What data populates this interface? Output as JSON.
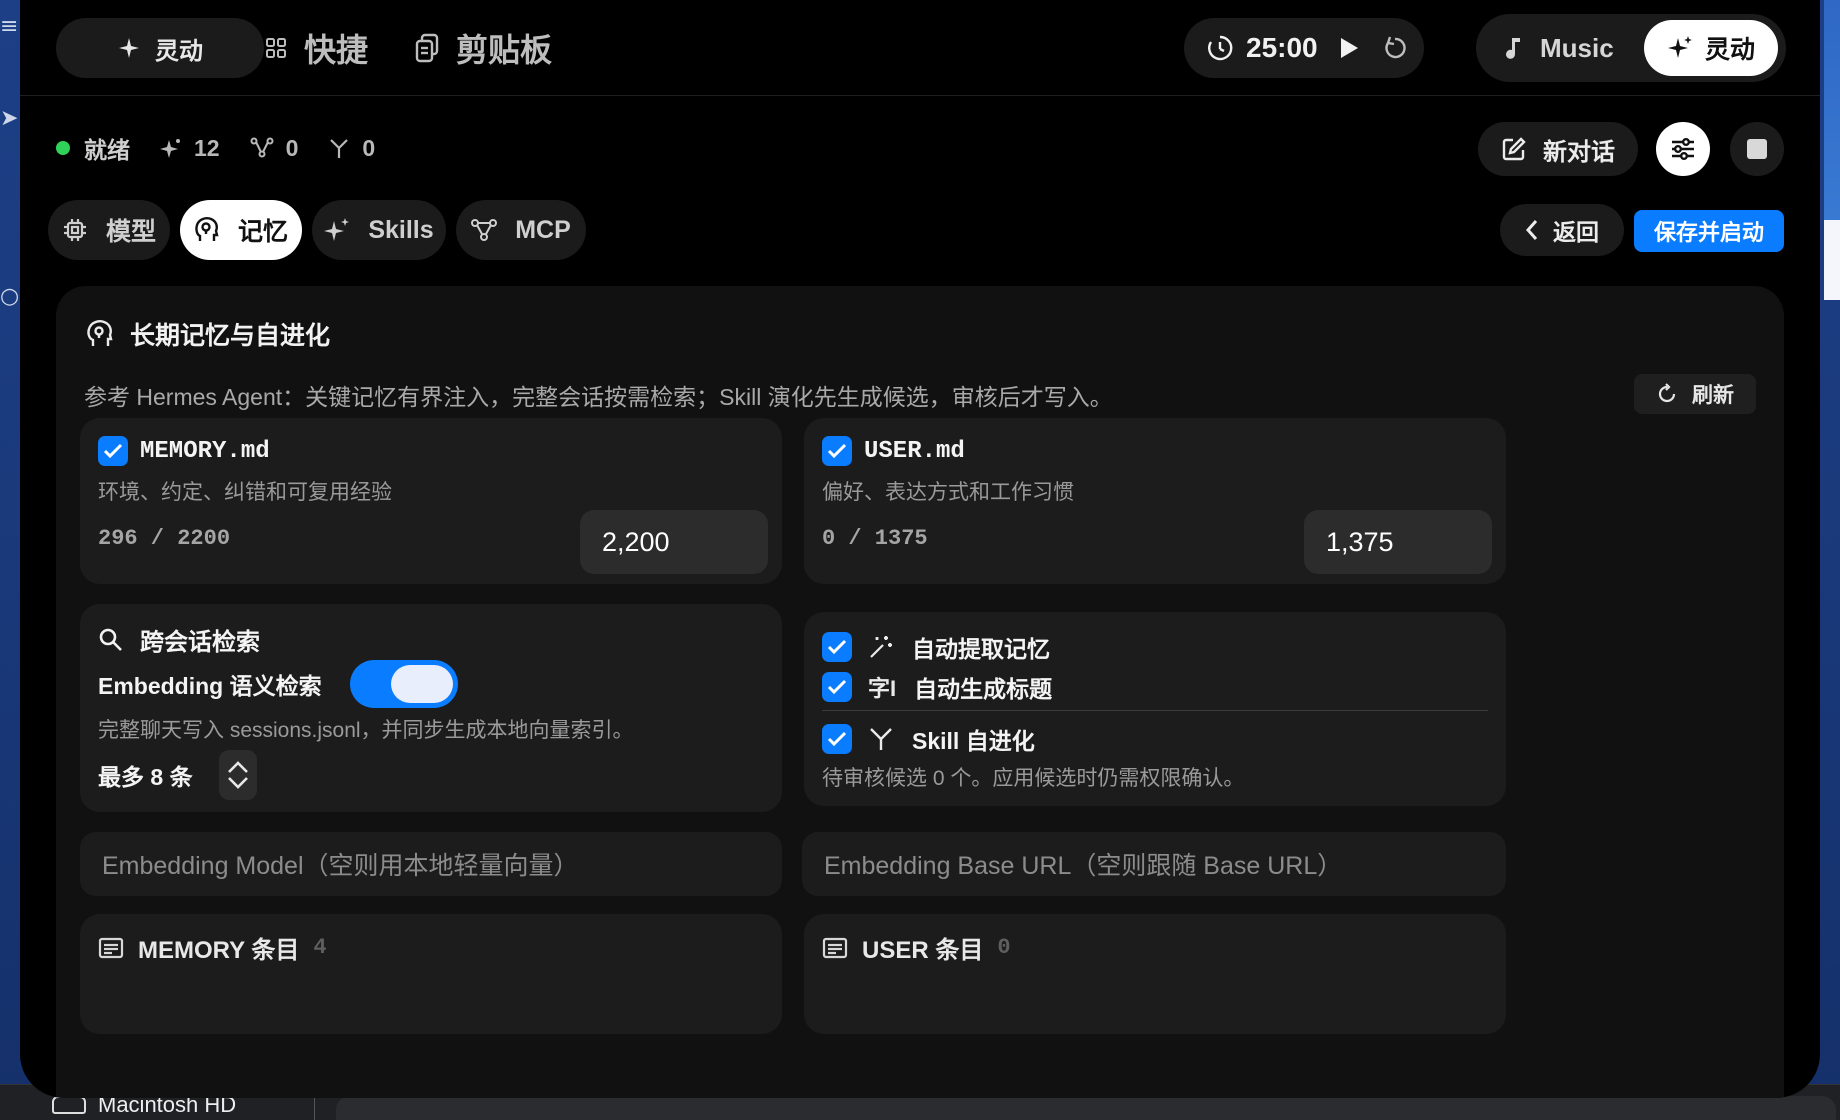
{
  "nav": {
    "dynamic_label": "灵动",
    "shortcuts_label": "快捷",
    "clipboard_label": "剪贴板"
  },
  "timer": {
    "time": "25:00"
  },
  "mode": {
    "music_label": "Music",
    "dynamic_label": "灵动"
  },
  "status": {
    "text": "就绪",
    "sparkle_count": "12",
    "nodes_count": "0",
    "branch_count": "0",
    "dot_color": "#30d158"
  },
  "actions": {
    "new_chat_label": "新对话"
  },
  "tabs": [
    {
      "label": "模型",
      "active": false
    },
    {
      "label": "记忆",
      "active": true
    },
    {
      "label": "Skills",
      "active": false
    },
    {
      "label": "MCP",
      "active": false
    }
  ],
  "toolbar": {
    "back_label": "返回",
    "save_label": "保存并启动"
  },
  "panel": {
    "title": "长期记忆与自进化",
    "description": "参考 Hermes Agent：关键记忆有界注入，完整会话按需检索；Skill 演化先生成候选，审核后才写入。",
    "refresh_label": "刷新"
  },
  "memory_file": {
    "name": "MEMORY.md",
    "checked": true,
    "description": "环境、约定、纠错和可复用经验",
    "usage": "296 / 2200",
    "limit_value": "2,200"
  },
  "user_file": {
    "name": "USER.md",
    "checked": true,
    "description": "偏好、表达方式和工作习惯",
    "usage": "0 / 1375",
    "limit_value": "1,375"
  },
  "search": {
    "title": "跨会话检索",
    "embedding_label": "Embedding 语义检索",
    "embedding_enabled": true,
    "note": "完整聊天写入 sessions.jsonl，并同步生成本地向量索引。",
    "max_label": "最多 8 条"
  },
  "auto": {
    "extract_label": "自动提取记忆",
    "extract_checked": true,
    "title_label": "自动生成标题",
    "title_checked": true,
    "skill_label": "Skill 自进化",
    "skill_checked": true,
    "skill_note": "待审核候选 0 个。应用候选时仍需权限确认。"
  },
  "inputs": {
    "model_placeholder": "Embedding Model（空则用本地轻量向量）",
    "base_url_placeholder": "Embedding Base URL（空则跟随 Base URL）"
  },
  "lists": {
    "memory_title": "MEMORY 条目",
    "memory_count": "4",
    "user_title": "USER 条目",
    "user_count": "0"
  },
  "finder": {
    "disk_label": "Macintosh HD"
  },
  "colors": {
    "accent": "#0a7cff",
    "panel_bg": "#111111",
    "card_bg": "#1c1c1c"
  }
}
